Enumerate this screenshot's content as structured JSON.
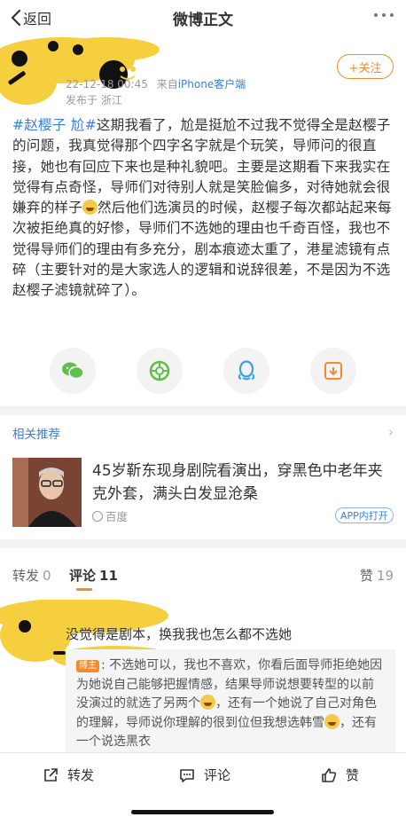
{
  "nav": {
    "back_label": "返回",
    "title": "微博正文"
  },
  "author": {
    "meta_time": "22-12-18 00:45",
    "meta_from": "来自",
    "meta_source": "iPhone客户端",
    "location": "发布于 浙江",
    "follow_label": "+关注"
  },
  "post": {
    "tags": [
      "#赵樱子 尬#"
    ],
    "segments": [
      "这期我看了，尬是挺尬不过我不觉得全是赵樱子的问题，我真觉得那个四字名字就是个玩笑，导师问的很直接，她也有回应下来也是种礼貌吧。主要是这期看下来我实在觉得有点奇怪，导师们对待别人就是笑脸偏多，对待她就会很嫌弃的样子",
      "然后他们选演员的时候，赵樱子每次都站起来每次被拒绝真的好惨，导师们不选她的理由也千奇百怪，我也不觉得导师们的理由有多充分，剧本痕迹太重了，港星滤镜有点碎（主要针对的是大家选人的逻辑和说辞很差，不是因为不选赵樱子滤镜就碎了）。"
    ],
    "emoji": "laughing-tears"
  },
  "share": [
    "wechat-icon",
    "moments-icon",
    "qq-icon",
    "save-image-icon"
  ],
  "related": {
    "heading": "相关推荐",
    "title": "45岁靳东现身剧院看演出，穿黑色中老年夹克外套，满头白发显沧桑",
    "source": "百度",
    "badge": "APP内打开"
  },
  "tabs": {
    "repost": {
      "label": "转发",
      "count": "0"
    },
    "comment": {
      "label": "评论",
      "count": "11"
    },
    "like": {
      "label": "赞",
      "count": "19"
    }
  },
  "comment": {
    "text": "没觉得是剧本，换我我也怎么都不选她",
    "reply_owner_badge": "博主",
    "reply_parts": [
      ": 不选她可以，我也不喜欢，你看后面导师拒绝她因为她说自己能够把握情感，结果导师说想要转型的以前没演过的就选了另两个",
      "，还有一个她说了自己对角色的理解，导师说你理解的很到位但我想选韩雪",
      "，还有一个说选黑衣"
    ]
  },
  "toolbar": {
    "repost": "转发",
    "comment": "评论",
    "like": "赞"
  },
  "colors": {
    "accent": "#f18a30",
    "link": "#3d7fd0",
    "text": "#333333",
    "muted": "#999999"
  }
}
